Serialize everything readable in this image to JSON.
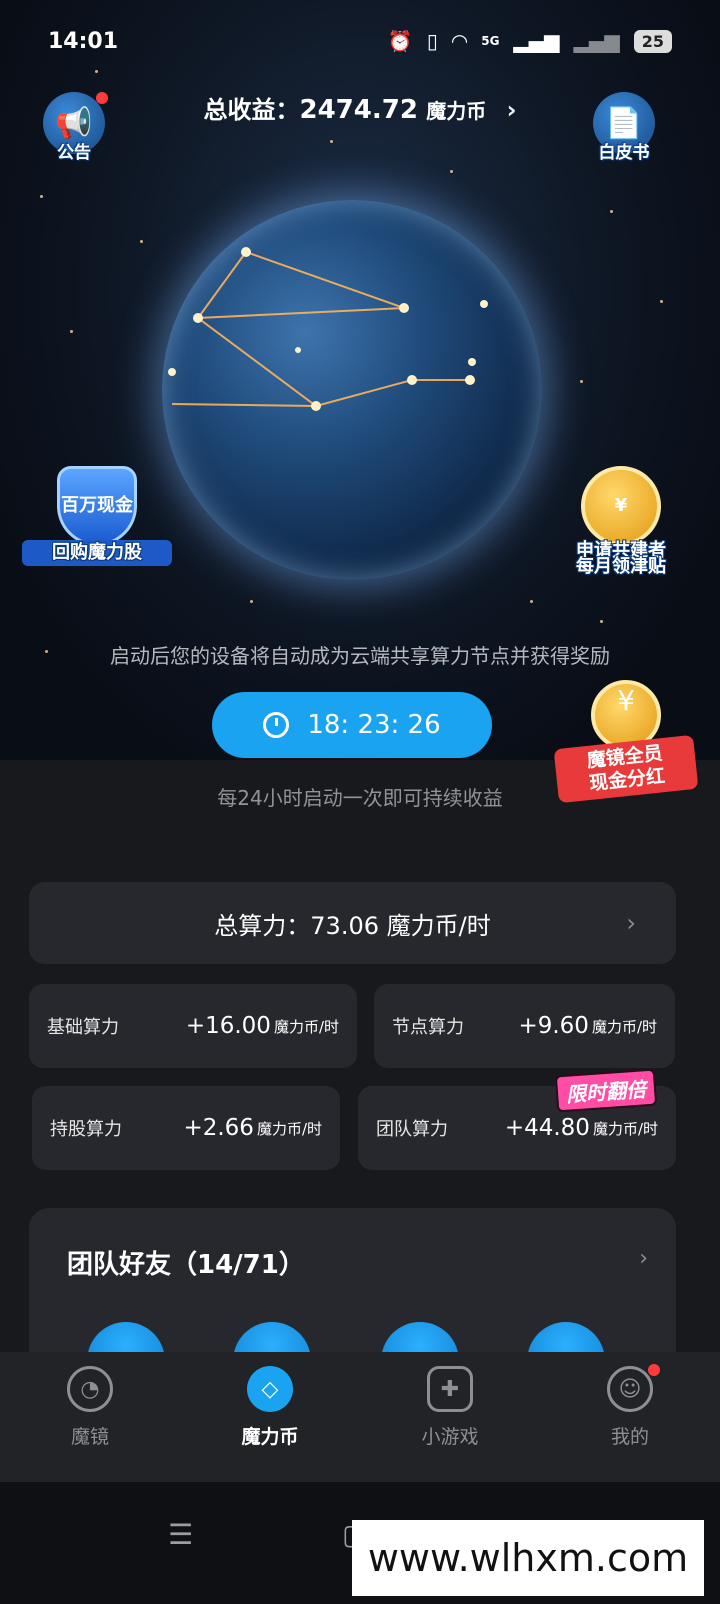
{
  "status": {
    "time": "14:01",
    "network": "5G",
    "battery": "25"
  },
  "header": {
    "earnings_label": "总收益：",
    "earnings_amount": "2474.72",
    "earnings_unit": "魔力币",
    "left_button": "公告",
    "right_button": "白皮书"
  },
  "badges": {
    "left_icon_text": "百万现金",
    "left_caption": "回购魔力股",
    "right_caption_1": "申请共建者",
    "right_caption_2": "每月领津贴",
    "right_icon_symbol": "¥"
  },
  "hero": {
    "hint": "启动后您的设备将自动成为云端共享算力节点并获得奖励",
    "timer": "18: 23: 26",
    "sub_hint": "每24小时启动一次即可持续收益"
  },
  "promo": {
    "caption_1": "魔镜全员",
    "caption_2": "现金分红"
  },
  "power": {
    "total_label": "总算力：73.06 魔力币/时",
    "limited_tag": "限时翻倍",
    "cards": [
      {
        "name": "基础算力",
        "value": "+16.00",
        "unit": "魔力币/时"
      },
      {
        "name": "节点算力",
        "value": "+9.60",
        "unit": "魔力币/时"
      },
      {
        "name": "持股算力",
        "value": "+2.66",
        "unit": "魔力币/时"
      },
      {
        "name": "团队算力",
        "value": "+44.80",
        "unit": "魔力币/时"
      }
    ]
  },
  "team": {
    "title": "团队好友（14/71）"
  },
  "nav": {
    "items": [
      {
        "label": "魔镜",
        "icon": "mirror-face-icon"
      },
      {
        "label": "魔力币",
        "icon": "coin-diamond-icon"
      },
      {
        "label": "小游戏",
        "icon": "gamepad-icon"
      },
      {
        "label": "我的",
        "icon": "profile-icon"
      }
    ]
  },
  "watermark": "www.wlhxm.com",
  "colors": {
    "accent": "#1aa3f0",
    "card": "#27282d",
    "background": "#18191d"
  }
}
